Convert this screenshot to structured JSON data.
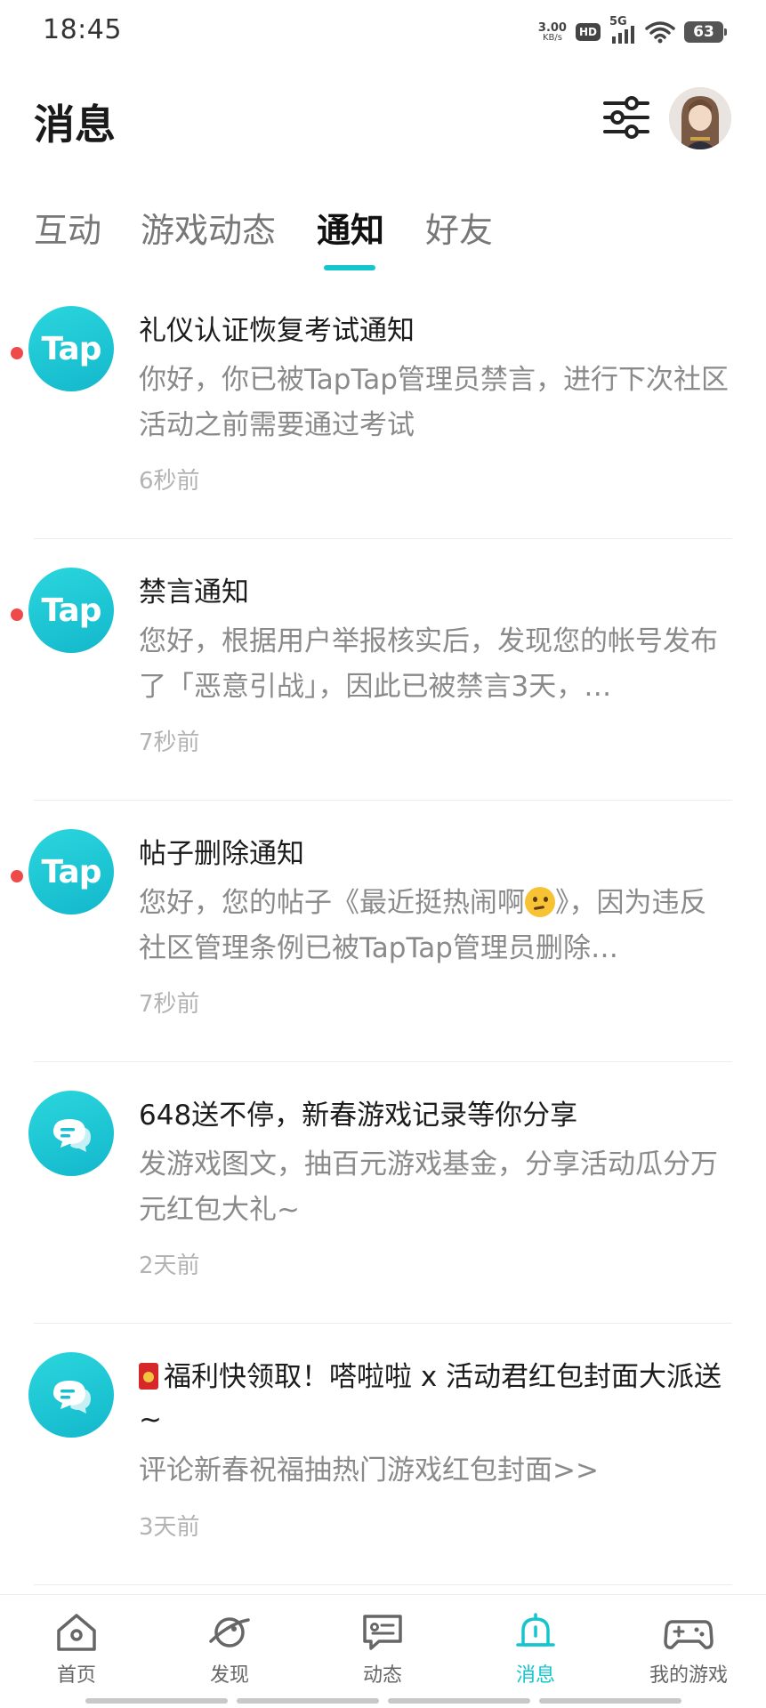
{
  "status_bar": {
    "time": "18:45",
    "net_speed_value": "3.00",
    "net_speed_unit": "KB/s",
    "hd": "HD",
    "network": "5G",
    "battery": "63"
  },
  "header": {
    "title": "消息",
    "filter_icon": "sliders-icon",
    "avatar_icon": "user-avatar"
  },
  "tabs": [
    {
      "label": "互动",
      "active": false
    },
    {
      "label": "游戏动态",
      "active": false
    },
    {
      "label": "通知",
      "active": true
    },
    {
      "label": "好友",
      "active": false
    }
  ],
  "notifications": [
    {
      "icon": "tap-logo",
      "icon_text": "Tap",
      "unread": true,
      "title": "礼仪认证恢复考试通知",
      "body": "你好，你已被TapTap管理员禁言，进行下次社区活动之前需要通过考试",
      "time": "6秒前"
    },
    {
      "icon": "tap-logo",
      "icon_text": "Tap",
      "unread": true,
      "title": "禁言通知",
      "body": "您好，根据用户举报核实后，发现您的帐号发布了「恶意引战」，因此已被禁言3天，…",
      "time": "7秒前"
    },
    {
      "icon": "tap-logo",
      "icon_text": "Tap",
      "unread": true,
      "title": "帖子删除通知",
      "body_before_emoji": "您好，您的帖子《最近挺热闹啊",
      "body_emoji": "thinking-face-emoji",
      "body_after_emoji": "》，因为违反社区管理条例已被TapTap管理员删除…",
      "time": "7秒前"
    },
    {
      "icon": "chat-bubble-icon",
      "unread": false,
      "title": "648送不停，新春游戏记录等你分享",
      "body": "发游戏图文，抽百元游戏基金，分享活动瓜分万元红包大礼~",
      "time": "2天前"
    },
    {
      "icon": "chat-bubble-icon",
      "unread": false,
      "title_icon": "red-envelope-emoji",
      "title": "福利快领取！嗒啦啦 x 活动君红包封面大派送~",
      "body": "评论新春祝福抽热门游戏红包封面>>",
      "time": "3天前"
    }
  ],
  "bottom_nav": [
    {
      "label": "首页",
      "icon": "home-icon",
      "active": false
    },
    {
      "label": "发现",
      "icon": "planet-icon",
      "active": false
    },
    {
      "label": "动态",
      "icon": "feed-chat-icon",
      "active": false
    },
    {
      "label": "消息",
      "icon": "bell-icon",
      "active": true
    },
    {
      "label": "我的游戏",
      "icon": "gamepad-icon",
      "active": false
    }
  ],
  "colors": {
    "accent": "#15c5ce",
    "unread_dot": "#ef4a4a",
    "title_text": "#1c1c1c",
    "body_text": "#8a8a8a",
    "time_text": "#b3b3b3"
  }
}
